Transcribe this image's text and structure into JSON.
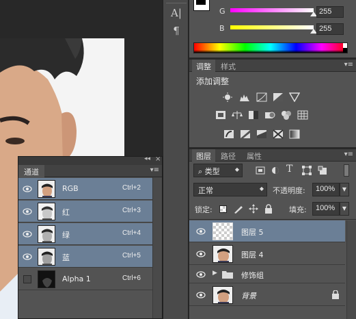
{
  "color_panel": {
    "g_label": "G",
    "b_label": "B",
    "g_value": "255",
    "b_value": "255"
  },
  "adjustments": {
    "tabs": [
      "调整",
      "样式"
    ],
    "add_label": "添加调整"
  },
  "layers_panel": {
    "tabs": [
      "图层",
      "路径",
      "属性"
    ],
    "filter_kind": "类型",
    "blend_mode": "正常",
    "opacity_label": "不透明度:",
    "opacity_value": "100%",
    "lock_label": "锁定:",
    "fill_label": "填充:",
    "fill_value": "100%",
    "layers": [
      {
        "name": "图层 5"
      },
      {
        "name": "图层 4"
      },
      {
        "name": "修饰组"
      },
      {
        "name": "背景"
      }
    ]
  },
  "channels_panel": {
    "tab": "通道",
    "channels": [
      {
        "name": "RGB",
        "shortcut": "Ctrl+2"
      },
      {
        "name": "红",
        "shortcut": "Ctrl+3"
      },
      {
        "name": "绿",
        "shortcut": "Ctrl+4"
      },
      {
        "name": "蓝",
        "shortcut": "Ctrl+5"
      },
      {
        "name": "Alpha 1",
        "shortcut": "Ctrl+6"
      }
    ]
  },
  "colors": {
    "panel_bg": "#535353",
    "selection": "#6b7f96",
    "dark_bg": "#282828"
  }
}
